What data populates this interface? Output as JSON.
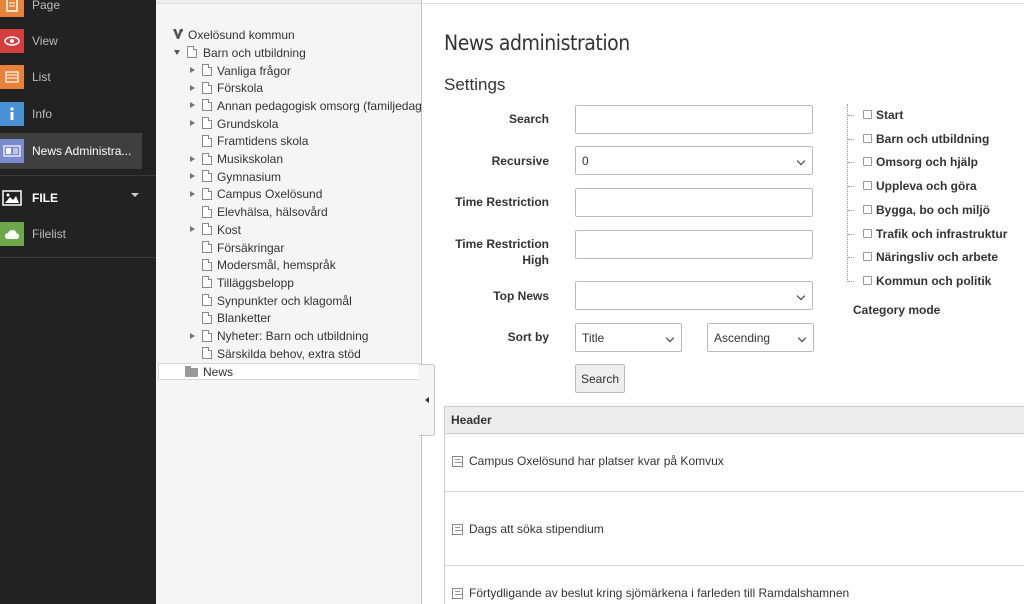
{
  "modules": {
    "items": [
      {
        "label": "Page",
        "icon": "page-icon",
        "color": "#e8813a"
      },
      {
        "label": "View",
        "icon": "eye-icon",
        "color": "#d33f3f"
      },
      {
        "label": "List",
        "icon": "list-icon",
        "color": "#e8813a"
      },
      {
        "label": "Info",
        "icon": "info-icon",
        "color": "#4a90d4"
      },
      {
        "label": "News Administra...",
        "icon": "news-icon",
        "color": "#7a8ccf"
      }
    ],
    "file_section": {
      "label": "FILE"
    },
    "filelist": {
      "label": "Filelist",
      "icon": "cloud-icon",
      "color": "#6fa84a"
    }
  },
  "tree": {
    "root": "Oxelösund kommun",
    "parent": "Barn och utbildning",
    "children": [
      "Vanliga frågor",
      "Förskola",
      "Annan pedagogisk omsorg (familjedag",
      "Grundskola",
      "Framtidens skola",
      "Musikskolan",
      "Gymnasium",
      "Campus Oxelösund",
      "Elevhälsa, hälsovård",
      "Kost",
      "Försäkringar",
      "Modersmål, hemspråk",
      "Tilläggsbelopp",
      "Synpunkter och klagomål",
      "Blanketter",
      "Nyheter: Barn och utbildning",
      "Särskilda behov, extra stöd"
    ],
    "selected": "News"
  },
  "main": {
    "title": "News administration",
    "subtitle": "Settings",
    "form": {
      "search_label": "Search",
      "search_value": "",
      "recursive_label": "Recursive",
      "recursive_value": "0",
      "time_label": "Time Restriction",
      "time_value": "",
      "time_high_label_1": "Time Restriction",
      "time_high_label_2": "High",
      "time_high_value": "",
      "top_news_label": "Top News",
      "top_news_value": "",
      "sort_label": "Sort by",
      "sort_field_value": "Title",
      "sort_dir_value": "Ascending",
      "search_button": "Search"
    },
    "categories": [
      "Start",
      "Barn och utbildning",
      "Omsorg och hjälp",
      "Uppleva och göra",
      "Bygga, bo och miljö",
      "Trafik och infrastruktur",
      "Näringsliv och arbete",
      "Kommun och politik"
    ],
    "category_mode_label": "Category mode",
    "table": {
      "header": "Header",
      "rows": [
        "Campus Oxelösund har platser kvar på Komvux",
        "Dags att söka stipendium",
        "Förtydligande av beslut kring sjömärkena i farleden till Ramdalshamnen"
      ]
    }
  }
}
